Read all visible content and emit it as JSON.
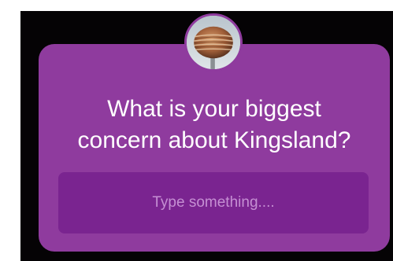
{
  "question_sticker": {
    "question_text": "What is your biggest\nconcern about Kingsland?",
    "answer_placeholder": "Type something....",
    "card_color": "#8f3b9e",
    "field_color": "#7a2490",
    "placeholder_color": "#c58fd3"
  },
  "avatar": {
    "icon": "profile-photo-sphere-sculpture"
  }
}
